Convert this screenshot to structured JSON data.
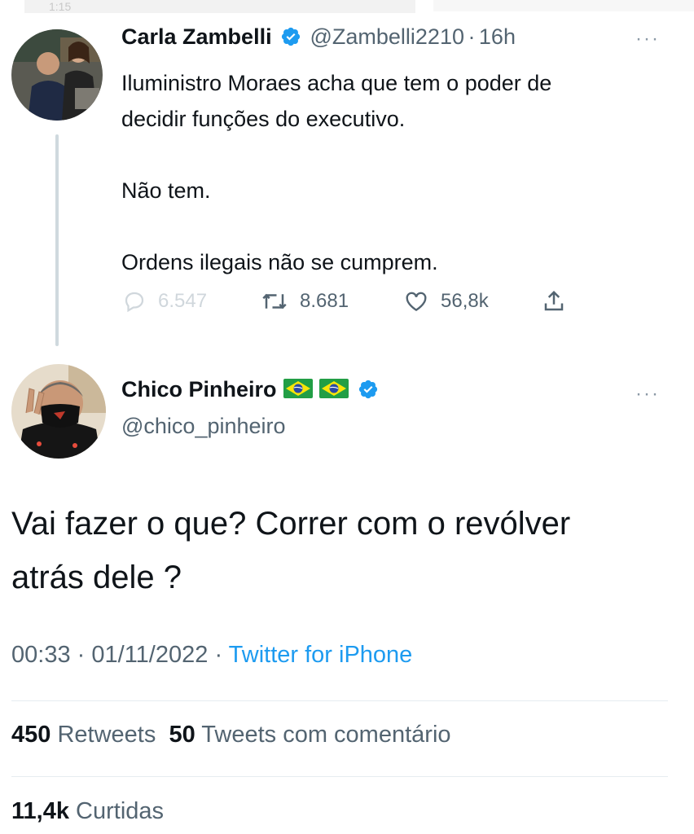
{
  "status_bar": {
    "time": "1:15"
  },
  "quoted_tweet": {
    "author_name": "Carla Zambelli",
    "handle": "@Zambelli2210",
    "separator": "·",
    "time_ago": "16h",
    "more": "···",
    "lines": [
      "Iluministro Moraes acha que tem o poder de",
      "decidir funções do executivo."
    ],
    "paragraph2": "Não tem.",
    "paragraph3": "Ordens ilegais não se cumprem.",
    "replies": "6.547",
    "retweets": "8.681",
    "likes": "56,8k"
  },
  "main_tweet": {
    "author_name": "Chico Pinheiro",
    "handle": "@chico_pinheiro",
    "more": "···",
    "text_line1": "Vai fazer o que? Correr com o revólver",
    "text_line2": "atrás dele ?",
    "time": "00:33",
    "dot1": "·",
    "date": "01/11/2022",
    "dot2": "·",
    "source": "Twitter for iPhone",
    "retweets_count": "450",
    "retweets_label": "Retweets",
    "quotes_count": "50",
    "quotes_label": "Tweets com comentário",
    "likes_count": "11,4k",
    "likes_label": "Curtidas"
  },
  "colors": {
    "text": "#0f1419",
    "secondary": "#536471",
    "link": "#1d9bf0",
    "verified": "#1d9bf0",
    "divider": "#e6ecf0"
  },
  "icons": [
    "reply-icon",
    "retweet-icon",
    "like-icon",
    "share-icon",
    "verified-badge-icon",
    "brazil-flag-icon",
    "more-icon"
  ]
}
